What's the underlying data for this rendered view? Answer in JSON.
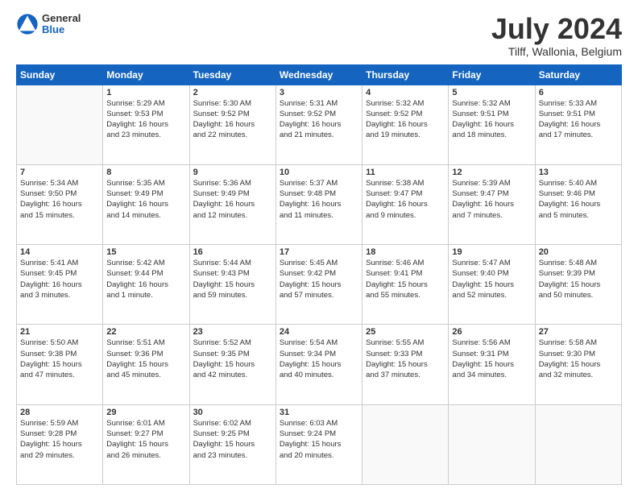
{
  "header": {
    "logo_general": "General",
    "logo_blue": "Blue",
    "month_title": "July 2024",
    "location": "Tilff, Wallonia, Belgium"
  },
  "days_of_week": [
    "Sunday",
    "Monday",
    "Tuesday",
    "Wednesday",
    "Thursday",
    "Friday",
    "Saturday"
  ],
  "weeks": [
    [
      {
        "day": "",
        "info": ""
      },
      {
        "day": "1",
        "info": "Sunrise: 5:29 AM\nSunset: 9:53 PM\nDaylight: 16 hours\nand 23 minutes."
      },
      {
        "day": "2",
        "info": "Sunrise: 5:30 AM\nSunset: 9:52 PM\nDaylight: 16 hours\nand 22 minutes."
      },
      {
        "day": "3",
        "info": "Sunrise: 5:31 AM\nSunset: 9:52 PM\nDaylight: 16 hours\nand 21 minutes."
      },
      {
        "day": "4",
        "info": "Sunrise: 5:32 AM\nSunset: 9:52 PM\nDaylight: 16 hours\nand 19 minutes."
      },
      {
        "day": "5",
        "info": "Sunrise: 5:32 AM\nSunset: 9:51 PM\nDaylight: 16 hours\nand 18 minutes."
      },
      {
        "day": "6",
        "info": "Sunrise: 5:33 AM\nSunset: 9:51 PM\nDaylight: 16 hours\nand 17 minutes."
      }
    ],
    [
      {
        "day": "7",
        "info": "Sunrise: 5:34 AM\nSunset: 9:50 PM\nDaylight: 16 hours\nand 15 minutes."
      },
      {
        "day": "8",
        "info": "Sunrise: 5:35 AM\nSunset: 9:49 PM\nDaylight: 16 hours\nand 14 minutes."
      },
      {
        "day": "9",
        "info": "Sunrise: 5:36 AM\nSunset: 9:49 PM\nDaylight: 16 hours\nand 12 minutes."
      },
      {
        "day": "10",
        "info": "Sunrise: 5:37 AM\nSunset: 9:48 PM\nDaylight: 16 hours\nand 11 minutes."
      },
      {
        "day": "11",
        "info": "Sunrise: 5:38 AM\nSunset: 9:47 PM\nDaylight: 16 hours\nand 9 minutes."
      },
      {
        "day": "12",
        "info": "Sunrise: 5:39 AM\nSunset: 9:47 PM\nDaylight: 16 hours\nand 7 minutes."
      },
      {
        "day": "13",
        "info": "Sunrise: 5:40 AM\nSunset: 9:46 PM\nDaylight: 16 hours\nand 5 minutes."
      }
    ],
    [
      {
        "day": "14",
        "info": "Sunrise: 5:41 AM\nSunset: 9:45 PM\nDaylight: 16 hours\nand 3 minutes."
      },
      {
        "day": "15",
        "info": "Sunrise: 5:42 AM\nSunset: 9:44 PM\nDaylight: 16 hours\nand 1 minute."
      },
      {
        "day": "16",
        "info": "Sunrise: 5:44 AM\nSunset: 9:43 PM\nDaylight: 15 hours\nand 59 minutes."
      },
      {
        "day": "17",
        "info": "Sunrise: 5:45 AM\nSunset: 9:42 PM\nDaylight: 15 hours\nand 57 minutes."
      },
      {
        "day": "18",
        "info": "Sunrise: 5:46 AM\nSunset: 9:41 PM\nDaylight: 15 hours\nand 55 minutes."
      },
      {
        "day": "19",
        "info": "Sunrise: 5:47 AM\nSunset: 9:40 PM\nDaylight: 15 hours\nand 52 minutes."
      },
      {
        "day": "20",
        "info": "Sunrise: 5:48 AM\nSunset: 9:39 PM\nDaylight: 15 hours\nand 50 minutes."
      }
    ],
    [
      {
        "day": "21",
        "info": "Sunrise: 5:50 AM\nSunset: 9:38 PM\nDaylight: 15 hours\nand 47 minutes."
      },
      {
        "day": "22",
        "info": "Sunrise: 5:51 AM\nSunset: 9:36 PM\nDaylight: 15 hours\nand 45 minutes."
      },
      {
        "day": "23",
        "info": "Sunrise: 5:52 AM\nSunset: 9:35 PM\nDaylight: 15 hours\nand 42 minutes."
      },
      {
        "day": "24",
        "info": "Sunrise: 5:54 AM\nSunset: 9:34 PM\nDaylight: 15 hours\nand 40 minutes."
      },
      {
        "day": "25",
        "info": "Sunrise: 5:55 AM\nSunset: 9:33 PM\nDaylight: 15 hours\nand 37 minutes."
      },
      {
        "day": "26",
        "info": "Sunrise: 5:56 AM\nSunset: 9:31 PM\nDaylight: 15 hours\nand 34 minutes."
      },
      {
        "day": "27",
        "info": "Sunrise: 5:58 AM\nSunset: 9:30 PM\nDaylight: 15 hours\nand 32 minutes."
      }
    ],
    [
      {
        "day": "28",
        "info": "Sunrise: 5:59 AM\nSunset: 9:28 PM\nDaylight: 15 hours\nand 29 minutes."
      },
      {
        "day": "29",
        "info": "Sunrise: 6:01 AM\nSunset: 9:27 PM\nDaylight: 15 hours\nand 26 minutes."
      },
      {
        "day": "30",
        "info": "Sunrise: 6:02 AM\nSunset: 9:25 PM\nDaylight: 15 hours\nand 23 minutes."
      },
      {
        "day": "31",
        "info": "Sunrise: 6:03 AM\nSunset: 9:24 PM\nDaylight: 15 hours\nand 20 minutes."
      },
      {
        "day": "",
        "info": ""
      },
      {
        "day": "",
        "info": ""
      },
      {
        "day": "",
        "info": ""
      }
    ]
  ]
}
